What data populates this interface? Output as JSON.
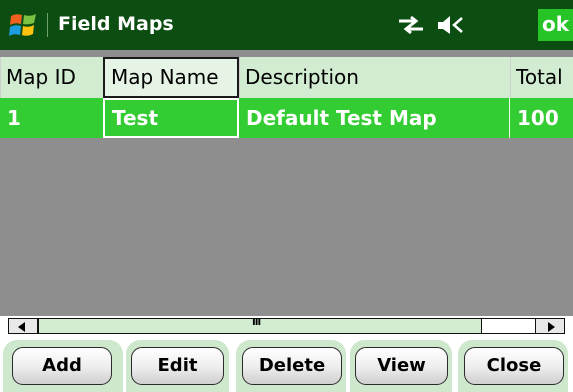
{
  "titlebar": {
    "title": "Field Maps",
    "ok_label": "ok",
    "icons": [
      "windows-start-icon",
      "connectivity-icon",
      "volume-icon"
    ]
  },
  "grid": {
    "columns": [
      "Map ID",
      "Map Name",
      "Description",
      "Total"
    ],
    "rows": [
      [
        "1",
        "Test",
        "Default Test Map",
        "100"
      ]
    ],
    "selected_row": 0,
    "focused_column": 1
  },
  "scrollbar": {
    "grip_label": "III"
  },
  "buttons": [
    "Add",
    "Edit",
    "Delete",
    "View",
    "Close"
  ],
  "colors": {
    "titlebar_bg": "#0c4d12",
    "header_bg": "#d1ecd1",
    "selected_row_bg": "#33cc33",
    "grid_empty_bg": "#8e8e8e",
    "ok_bg": "#27c427"
  }
}
